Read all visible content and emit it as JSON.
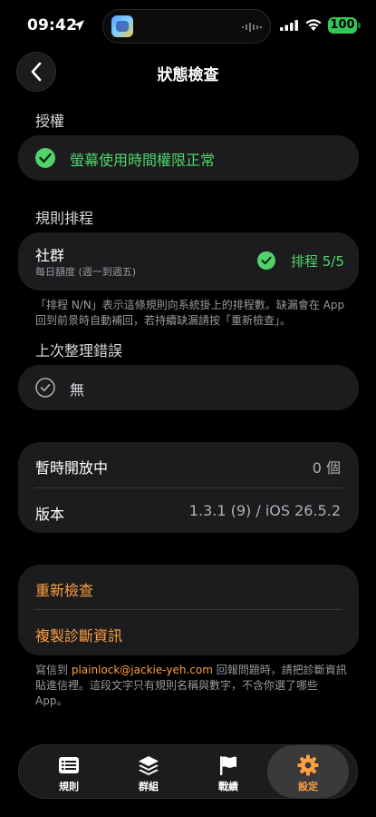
{
  "status_bar": {
    "time": "09:42",
    "battery": "100"
  },
  "header": {
    "title": "狀態檢查"
  },
  "authorization": {
    "section_title": "授權",
    "status_text": "螢幕使用時間權限正常"
  },
  "rule_schedule": {
    "section_title": "規則排程",
    "rule_name": "社群",
    "rule_subtitle": "每日額度 (週一到週五)",
    "schedule_status": "排程 5/5",
    "footnote": "「排程 N/N」表示這條規則向系統掛上的排程數。缺漏會在 App 回到前景時自動補回，若持續缺漏請按「重新檢查」。"
  },
  "last_error": {
    "section_title": "上次整理錯誤",
    "value": "無"
  },
  "info": {
    "temp_open_label": "暫時開放中",
    "temp_open_value": "0 個",
    "version_label": "版本",
    "version_value": "1.3.1 (9) / iOS 26.5.2"
  },
  "actions": {
    "recheck_label": "重新檢查",
    "copy_diag_label": "複製診斷資訊"
  },
  "contact": {
    "prefix": "寫信到 ",
    "email": "plainlock@jackie-yeh.com",
    "suffix": " 回報問題時，請把診斷資訊貼進信裡。這段文字只有規則名稱與數字，不含你選了哪些 App。"
  },
  "tabs": [
    {
      "label": "規則",
      "icon": "list-icon"
    },
    {
      "label": "群組",
      "icon": "layers-icon"
    },
    {
      "label": "戰績",
      "icon": "flag-icon"
    },
    {
      "label": "設定",
      "icon": "gear-icon"
    }
  ],
  "colors": {
    "accent_green": "#4fd36a",
    "accent_orange": "#ff9f40",
    "card_bg": "#1c1c1e"
  }
}
